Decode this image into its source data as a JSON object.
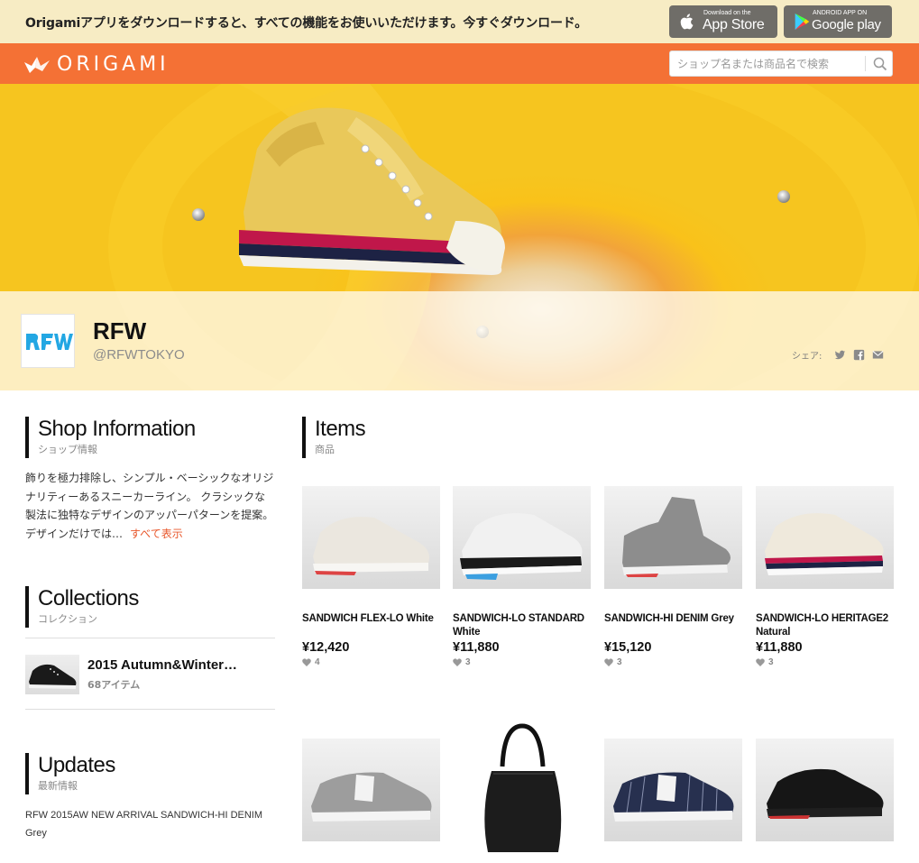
{
  "banner": {
    "message": "Origamiアプリをダウンロードすると、すべての機能をお使いいただけます。今すぐダウンロード。",
    "appstore": {
      "small": "Download on the",
      "big": "App Store"
    },
    "googleplay": {
      "small": "ANDROID APP ON",
      "big": "Google play"
    }
  },
  "header": {
    "logo_text": "ORIGAMI",
    "search_placeholder": "ショップ名または商品名で検索"
  },
  "shop": {
    "name": "RFW",
    "handle": "@RFWTOKYO",
    "share_label": "シェア:"
  },
  "shop_info": {
    "title": "Shop Information",
    "subtitle": "ショップ情報",
    "description": "飾りを極力排除し、シンプル・ベーシックなオリジナリティーあるスニーカーライン。 クラシックな製法に独特なデザインのアッパーパターンを提案。デザインだけでは…",
    "more_label": "すべて表示"
  },
  "collections": {
    "title": "Collections",
    "subtitle": "コレクション",
    "items": [
      {
        "title": "2015 Autumn&Winter…",
        "count": "68アイテム"
      }
    ]
  },
  "updates": {
    "title": "Updates",
    "subtitle": "最新情報",
    "text": "RFW 2015AW NEW ARRIVAL SANDWICH-HI DENIM Grey"
  },
  "items_section": {
    "title": "Items",
    "subtitle": "商品",
    "items": [
      {
        "name": "SANDWICH FLEX-LO White",
        "price": "¥12,420",
        "likes": "4"
      },
      {
        "name": "SANDWICH-LO STANDARD White",
        "price": "¥11,880",
        "likes": "3"
      },
      {
        "name": "SANDWICH-HI DENIM Grey",
        "price": "¥15,120",
        "likes": "3"
      },
      {
        "name": "SANDWICH-LO HERITAGE2 Natural",
        "price": "¥11,880",
        "likes": "3"
      }
    ]
  },
  "colors": {
    "header_orange": "#f47135",
    "banner_bg": "#f7ecc4",
    "accent_link": "#e8562a"
  },
  "icons": [
    "apple-icon",
    "google-play-icon",
    "origami-crane-icon",
    "search-icon",
    "twitter-icon",
    "facebook-icon",
    "mail-icon",
    "heart-icon"
  ]
}
